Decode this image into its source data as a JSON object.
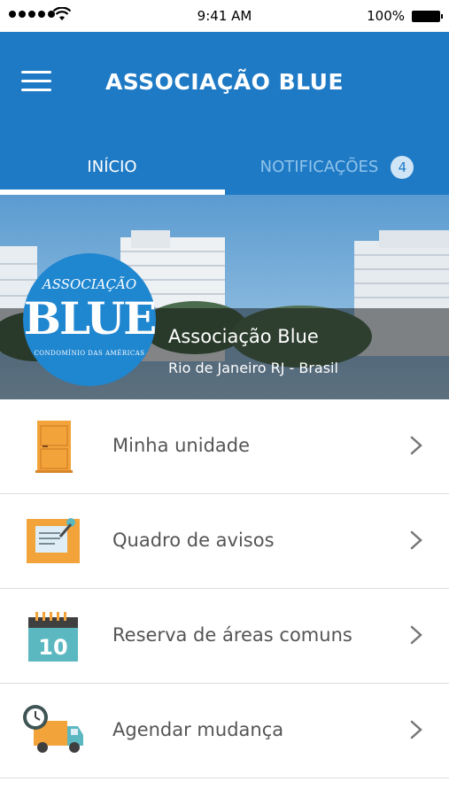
{
  "status_bar": {
    "time": "9:41 AM",
    "battery": "100%"
  },
  "header": {
    "title": "ASSOCIAÇÃO BLUE",
    "tabs": [
      {
        "label": "INÍCIO",
        "active": true
      },
      {
        "label": "NOTIFICAÇÕES",
        "badge": "4",
        "active": false
      }
    ]
  },
  "hero": {
    "logo": {
      "line1": "ASSOCIAÇÃO",
      "line2": "BLUE",
      "line3": "CONDOMÍNIO DAS AMÉRICAS"
    },
    "name": "Associação Blue",
    "location": "Rio de Janeiro RJ - Brasil"
  },
  "menu": [
    {
      "label": "Minha unidade",
      "icon": "door-icon"
    },
    {
      "label": "Quadro de avisos",
      "icon": "notice-board-icon"
    },
    {
      "label": "Reserva de áreas comuns",
      "icon": "calendar-icon"
    },
    {
      "label": "Agendar mudança",
      "icon": "moving-truck-icon"
    }
  ],
  "colors": {
    "primary": "#1f7ac5",
    "accent": "#f2a33a",
    "calendar": "#5cb8c0"
  }
}
